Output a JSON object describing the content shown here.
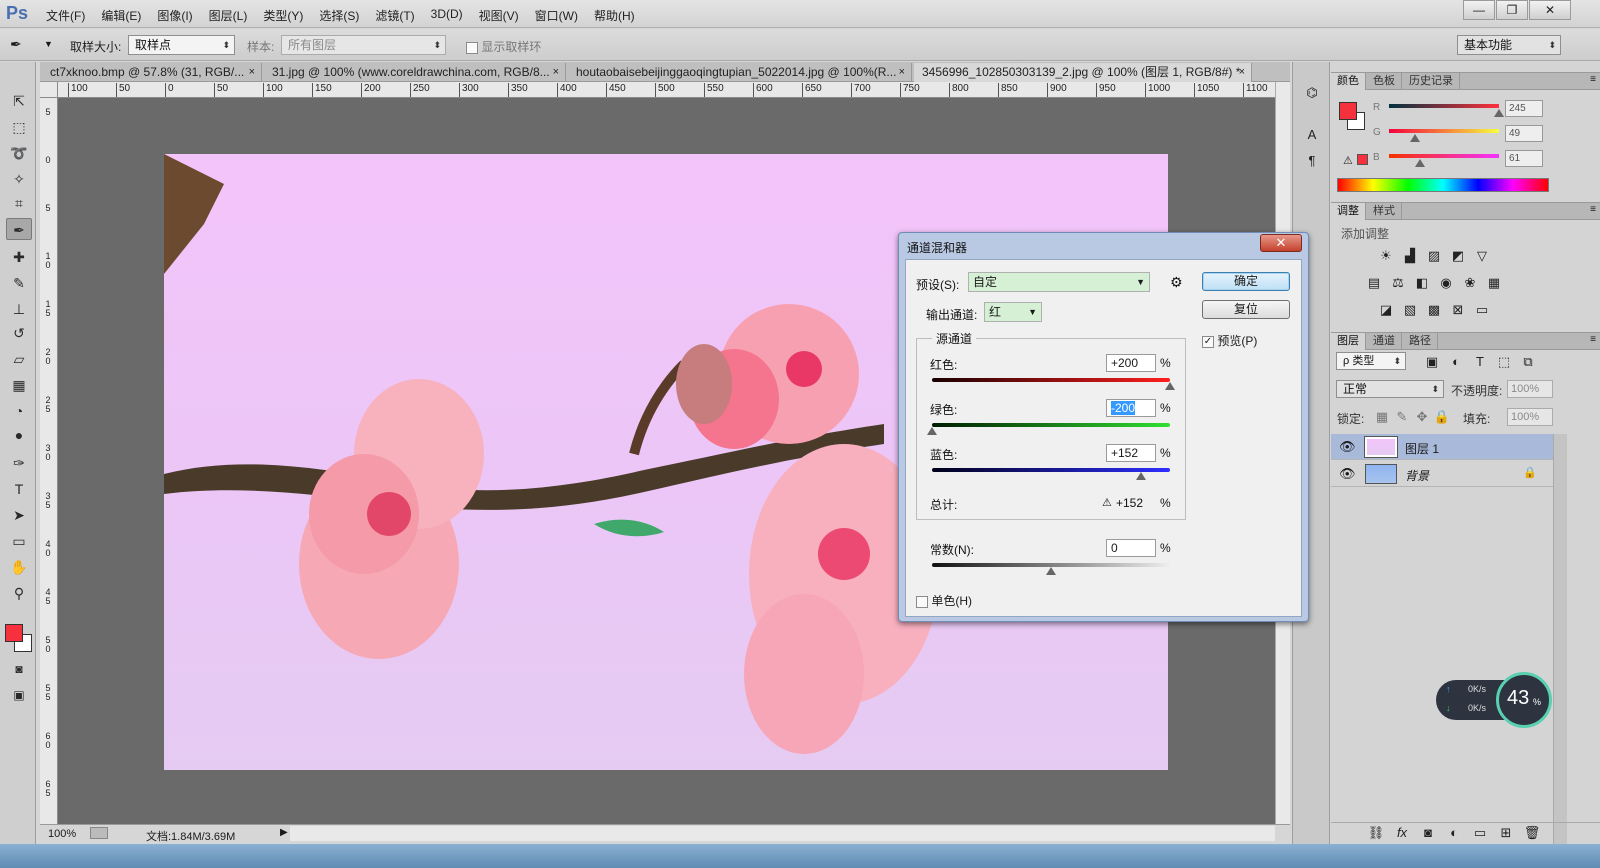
{
  "app": {
    "logo": "Ps"
  },
  "menu": [
    "文件(F)",
    "编辑(E)",
    "图像(I)",
    "图层(L)",
    "类型(Y)",
    "选择(S)",
    "滤镜(T)",
    "3D(D)",
    "视图(V)",
    "窗口(W)",
    "帮助(H)"
  ],
  "window_controls": {
    "minimize": "—",
    "restore": "❐",
    "close": "✕"
  },
  "options": {
    "sample_size_label": "取样大小:",
    "sample_size_value": "取样点",
    "sample_label": "样本:",
    "sample_value": "所有图层",
    "show_ring_label": "显示取样环",
    "workspace": "基本功能"
  },
  "doc_tabs": [
    {
      "title": "ct7xknoo.bmp @ 57.8% (31, RGB/...",
      "close": "×"
    },
    {
      "title": "31.jpg @ 100% (www.coreldrawchina.com, RGB/8...",
      "close": "×"
    },
    {
      "title": "houtaobaisebeijinggaoqingtupian_5022014.jpg @ 100%(R...",
      "close": "×"
    },
    {
      "title": "3456996_102850303139_2.jpg @ 100% (图层 1, RGB/8#) *",
      "close": "×"
    }
  ],
  "ruler_h": [
    "100",
    "50",
    "0",
    "50",
    "100",
    "150",
    "200",
    "250",
    "300",
    "350",
    "400",
    "450",
    "500",
    "550",
    "600",
    "650",
    "700",
    "750",
    "800",
    "850",
    "900",
    "950",
    "1000",
    "1050",
    "1100"
  ],
  "ruler_v": [
    "5",
    "0",
    "5",
    "1 0",
    "1 5",
    "2 0",
    "2 5",
    "3 0",
    "3 5",
    "4 0",
    "4 5",
    "5 0",
    "5 5",
    "6 0",
    "6 5"
  ],
  "status": {
    "zoom": "100%",
    "doc": "文档:1.84M/3.69M"
  },
  "color_panel": {
    "tabs": [
      "颜色",
      "色板",
      "历史记录"
    ],
    "r_label": "R",
    "g_label": "G",
    "b_label": "B",
    "r": "245",
    "g": "49",
    "b": "61",
    "fg_color": "#f5313d"
  },
  "adjust_panel": {
    "tabs": [
      "调整",
      "样式"
    ],
    "heading": "添加调整"
  },
  "layers_panel": {
    "tabs": [
      "图层",
      "通道",
      "路径"
    ],
    "filter": "ρ 类型",
    "blend_mode": "正常",
    "opacity_label": "不透明度:",
    "opacity": "100%",
    "lock_label": "锁定:",
    "fill_label": "填充:",
    "fill": "100%",
    "layers": [
      {
        "name": "图层 1",
        "selected": true
      },
      {
        "name": "背景",
        "selected": false
      }
    ]
  },
  "dialog": {
    "title": "通道混和器",
    "close": "✕",
    "preset_label": "预设(S):",
    "preset_value": "自定",
    "ok": "确定",
    "reset": "复位",
    "preview_label": "预览(P)",
    "output_label": "输出通道:",
    "output_value": "红",
    "source_group": "源通道",
    "red_label": "红色:",
    "red_value": "+200",
    "red": 200,
    "green_label": "绿色:",
    "green_value": "-200",
    "green": -200,
    "blue_label": "蓝色:",
    "blue_value": "+152",
    "blue": 152,
    "pct": "%",
    "total_label": "总计:",
    "total_value": "+152",
    "constant_label": "常数(N):",
    "constant_value": "0",
    "constant": 0,
    "mono_label": "单色(H)"
  },
  "net_widget": {
    "up": "0K/s",
    "down": "0K/s",
    "percent": "43",
    "unit": "%"
  }
}
